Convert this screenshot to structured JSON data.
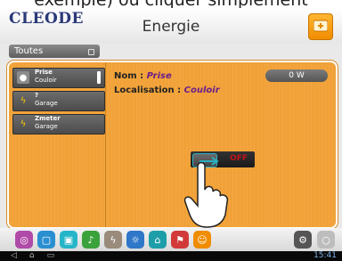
{
  "caption": "exemple) ou cliquer simplement",
  "header": {
    "logo": "CLEODE",
    "title": "Energie"
  },
  "filter": {
    "label": "Toutes"
  },
  "devices": [
    {
      "name": "Prise",
      "location": "Couloir",
      "icon": "plug-icon",
      "selected": true
    },
    {
      "name": "?",
      "location": "Garage",
      "icon": "lightning-icon",
      "selected": false
    },
    {
      "name": "Zmeter",
      "location": "Garage",
      "icon": "lightning-icon",
      "selected": false
    }
  ],
  "details": {
    "name_label": "Nom :",
    "name_value": "Prise",
    "location_label": "Localisation :",
    "location_value": "Couloir",
    "power": "0 W"
  },
  "switch": {
    "state": "OFF"
  },
  "statusbar": {
    "time": "15:41"
  },
  "colors": {
    "accent": "#f2a33c",
    "brand": "#2a3a78"
  }
}
